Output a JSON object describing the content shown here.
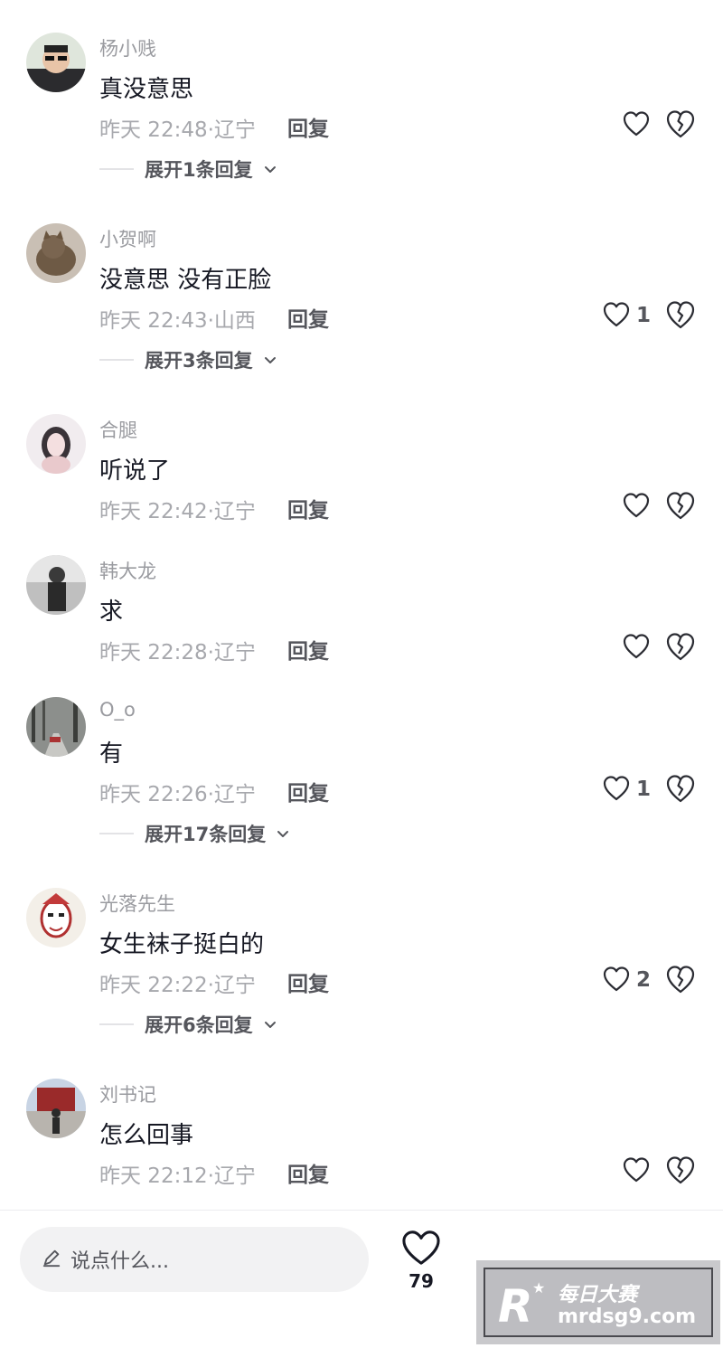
{
  "comments": [
    {
      "username": "杨小贱",
      "content": "真没意思",
      "time": "昨天 22:48",
      "location": "辽宁",
      "reply_label": "回复",
      "likes": "",
      "expand": "展开1条回复"
    },
    {
      "username": "小贺啊",
      "content": "没意思 没有正脸",
      "time": "昨天 22:43",
      "location": "山西",
      "reply_label": "回复",
      "likes": "1",
      "expand": "展开3条回复"
    },
    {
      "username": "合腿",
      "content": "听说了",
      "time": "昨天 22:42",
      "location": "辽宁",
      "reply_label": "回复",
      "likes": "",
      "expand": ""
    },
    {
      "username": "韩大龙",
      "content": "求",
      "time": "昨天 22:28",
      "location": "辽宁",
      "reply_label": "回复",
      "likes": "",
      "expand": ""
    },
    {
      "username": "O_o",
      "content": "有",
      "time": "昨天 22:26",
      "location": "辽宁",
      "reply_label": "回复",
      "likes": "1",
      "expand": "展开17条回复"
    },
    {
      "username": "光落先生",
      "content": "女生袜子挺白的",
      "time": "昨天 22:22",
      "location": "辽宁",
      "reply_label": "回复",
      "likes": "2",
      "expand": "展开6条回复"
    },
    {
      "username": "刘书记",
      "content": "怎么回事",
      "time": "昨天 22:12",
      "location": "辽宁",
      "reply_label": "回复",
      "likes": "",
      "expand": ""
    }
  ],
  "meta_separator": "·",
  "composer": {
    "placeholder": "说点什么...",
    "icon": "pencil-icon"
  },
  "bottom_like": {
    "count": "79",
    "icon": "heart-icon"
  },
  "watermark": {
    "title": "每日大赛",
    "url": "mrdsg9.com",
    "logo": "R"
  },
  "colors": {
    "text": "#161823",
    "secondary": "#a7a8ad",
    "username": "#9a9ba0",
    "input_bg": "#f2f2f3"
  },
  "avatars": [
    "man-sunglasses",
    "cat",
    "anime-girl",
    "bw-person",
    "forest-road",
    "opera-mask",
    "building-person"
  ]
}
